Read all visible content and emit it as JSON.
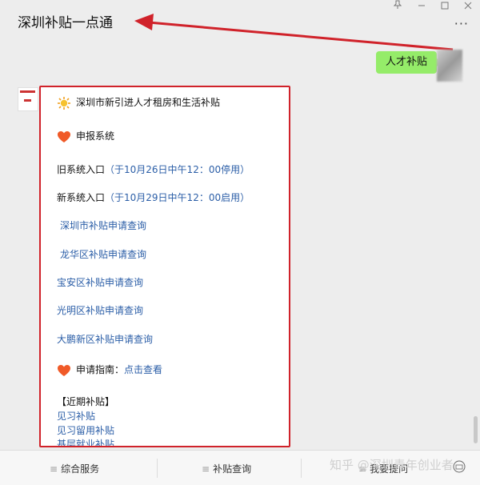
{
  "window": {
    "title": "深圳补贴一点通",
    "pin_icon": "pin-icon",
    "minimize_icon": "minimize-icon",
    "maximize_icon": "maximize-icon",
    "close_icon": "close-icon",
    "more_label": "···"
  },
  "user_message": {
    "text": "人才补贴"
  },
  "bot_message": {
    "title": "深圳市新引进人才租房和生活补贴",
    "section_report": "申报系统",
    "old_entry": "旧系统入口",
    "old_note": "（于10月26日中午12：00停用）",
    "new_entry": "新系统入口",
    "new_note": "（于10月29日中午12：00启用）",
    "links": [
      "深圳市补贴申请查询",
      "龙华区补贴申请查询",
      "宝安区补贴申请查询",
      "光明区补贴申请查询",
      "大鹏新区补贴申请查询"
    ],
    "guide_label": "申请指南：",
    "guide_link": "点击查看",
    "recent_heading": "【近期补贴】",
    "recent_links": [
      "见习补贴",
      "见习留用补贴",
      "基层就业补贴"
    ]
  },
  "menu": {
    "items": [
      "综合服务",
      "补贴查询",
      "我要提问"
    ]
  },
  "watermark": "知乎 @深圳青年创业者",
  "colors": {
    "annotation_red": "#d0222a",
    "bubble_green": "#95ec69",
    "link_blue": "#2b5ea7"
  }
}
